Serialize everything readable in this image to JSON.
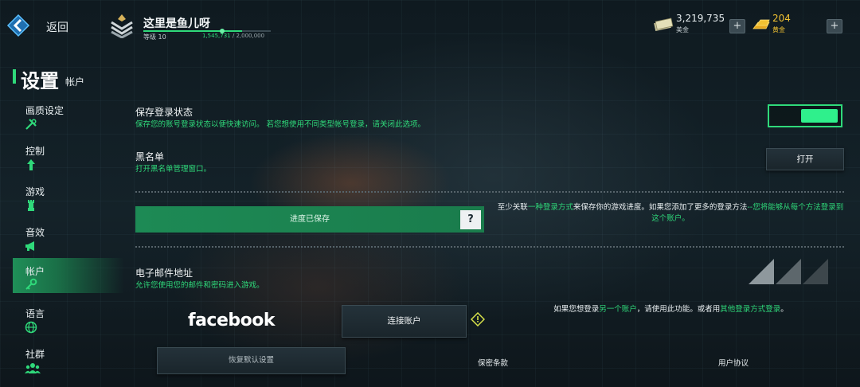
{
  "header": {
    "back_label": "返回",
    "player_name": "这里是鱼儿呀",
    "level_label": "等级 10",
    "xp_current": "1,545,731",
    "xp_total": "/ 2,000,000",
    "xp_progress": 0.773,
    "cash_value": "3,219,735",
    "cash_label": "美金",
    "gold_value": "204",
    "gold_label": "黄金",
    "plus_symbol": "+"
  },
  "sidebar": {
    "title": "设置",
    "subtitle": "帐户",
    "items": [
      {
        "label": "画质设定",
        "icon": "tools-icon"
      },
      {
        "label": "控制",
        "icon": "arrow-up-icon"
      },
      {
        "label": "游戏",
        "icon": "chess-rook-icon"
      },
      {
        "label": "音效",
        "icon": "megaphone-icon"
      },
      {
        "label": "帐户",
        "icon": "key-icon",
        "active": true
      },
      {
        "label": "语言",
        "icon": "globe-icon"
      },
      {
        "label": "社群",
        "icon": "people-icon"
      }
    ]
  },
  "main": {
    "save_login": {
      "title": "保存登录状态",
      "desc": "保存您的账号登录状态以便快速访问。 若您想使用不同类型帐号登录，请关闭此选项。",
      "enabled": true
    },
    "blacklist": {
      "title": "黑名单",
      "desc": "打开黑名单管理窗口。",
      "button": "打开"
    },
    "progress": {
      "label": "进度已保存",
      "help": "?",
      "note_prefix": "至少关联",
      "note_link": "一种登录方式",
      "note_mid": "来保存你的游戏进度。如果您添加了更多的登录方法",
      "note_suffix": "--您将能够从每个方法登录到这个账户。"
    },
    "email": {
      "title": "电子邮件地址",
      "desc": "允许您使用您的邮件和密码进入游戏。"
    },
    "facebook": {
      "logo": "facebook",
      "connect_button": "连接账户",
      "note_prefix": "如果您想登录",
      "note_link1": "另一个账户",
      "note_mid": "，请使用此功能。或者用",
      "note_link2": "其他登录方式登录",
      "note_suffix": "。"
    },
    "footer": {
      "restore": "恢复默认设置",
      "privacy": "保密条款",
      "terms": "用户协议"
    }
  },
  "colors": {
    "accent": "#2fd97a",
    "gold": "#f2c232",
    "background": "#10191f"
  }
}
